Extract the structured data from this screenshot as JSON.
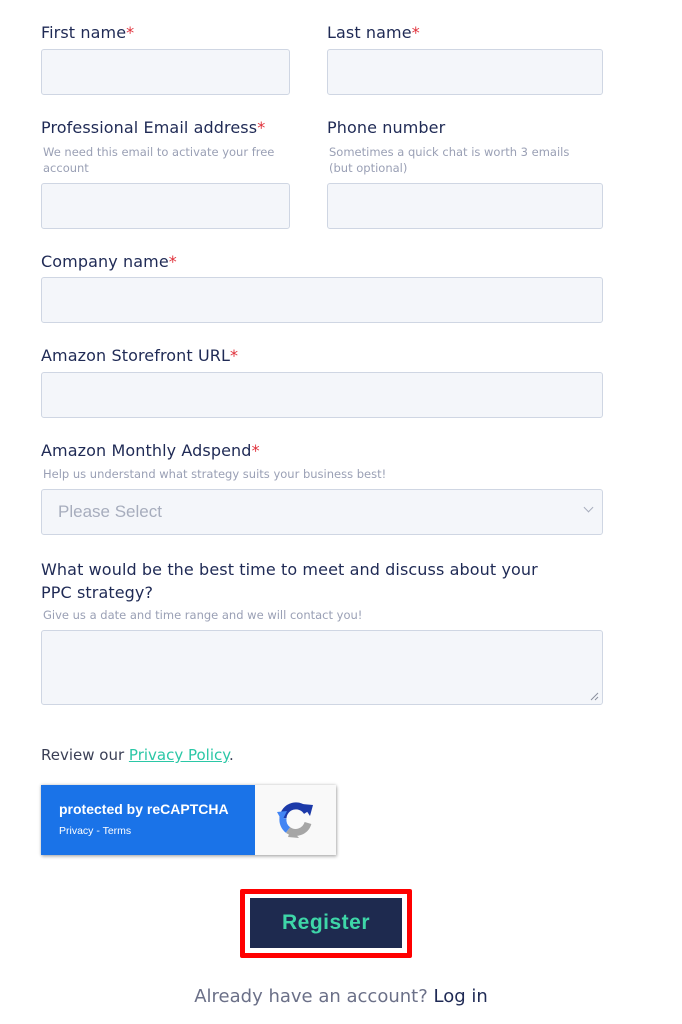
{
  "form": {
    "first_name": {
      "label": "First name",
      "required": "*",
      "value": ""
    },
    "last_name": {
      "label": "Last name",
      "required": "*",
      "value": ""
    },
    "email": {
      "label": "Professional Email address",
      "required": "*",
      "help_line1": "We need this email to activate your free",
      "help_line2": "account",
      "value": ""
    },
    "phone": {
      "label": "Phone number",
      "help_line1": "Sometimes a quick chat is worth 3 emails",
      "help_line2": "(but optional)",
      "value": ""
    },
    "company": {
      "label": "Company name",
      "required": "*",
      "value": ""
    },
    "storefront": {
      "label": "Amazon Storefront URL",
      "required": "*",
      "value": ""
    },
    "adspend": {
      "label": "Amazon Monthly Adspend",
      "required": "*",
      "help": "Help us understand what strategy suits your business best!",
      "selected": "Please Select"
    },
    "meeting": {
      "label_line1": "What would be the best time to meet and discuss about your",
      "label_line2": "PPC strategy?",
      "help": "Give us a date and time range and we will contact you!",
      "value": ""
    },
    "privacy": {
      "prefix": "Review our ",
      "link": "Privacy Policy",
      "suffix": "."
    },
    "recaptcha": {
      "title": "protected by reCAPTCHA",
      "links": "Privacy - Terms"
    },
    "register_label": "Register",
    "already": {
      "text": "Already have an account? ",
      "link": "Log in"
    }
  },
  "colors": {
    "label": "#1f2a55",
    "required": "#e0303a",
    "help": "#9aa0b5",
    "input_bg": "#f4f6fa",
    "accent_green": "#3ed6a8",
    "button_bg": "#1e2a4f",
    "highlight": "#ff0000",
    "recaptcha_blue": "#1a73e8"
  },
  "icons": [
    "recaptcha-logo-icon",
    "chevron-down-icon",
    "resize-handle-icon"
  ]
}
